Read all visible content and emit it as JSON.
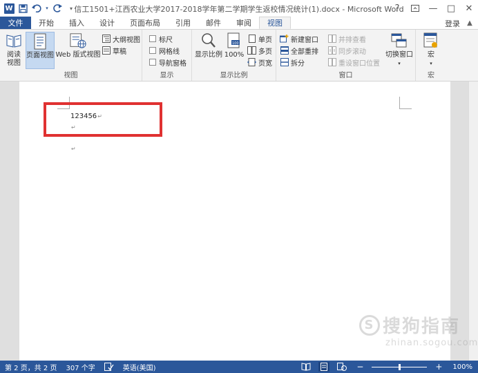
{
  "window": {
    "title": "信工1501+江西农业大学2017-2018学年第二学期学生返校情况统计(1).docx - Microsoft Word",
    "help": "?",
    "minimize": "—",
    "restore": "□",
    "close": "✕"
  },
  "quick_access": {
    "app_icon": "word-icon",
    "save_icon": "save-icon",
    "undo_icon": "undo-icon",
    "redo_icon": "redo-icon",
    "customize_icon": "customize-icon"
  },
  "tabs": [
    {
      "label": "文件"
    },
    {
      "label": "开始"
    },
    {
      "label": "插入"
    },
    {
      "label": "设计"
    },
    {
      "label": "页面布局"
    },
    {
      "label": "引用"
    },
    {
      "label": "邮件"
    },
    {
      "label": "审阅"
    },
    {
      "label": "视图"
    }
  ],
  "active_tab": "视图",
  "login": "登录",
  "ribbon": {
    "views": {
      "label": "视图",
      "read_mode": "阅读\n视图",
      "read_mode_1": "阅读",
      "read_mode_2": "视图",
      "print_layout": "页面视图",
      "web_layout": "Web 版式视图",
      "outline": "大纲视图",
      "draft": "草稿"
    },
    "show": {
      "label": "显示",
      "ruler": "标尺",
      "gridlines": "网格线",
      "nav_pane": "导航窗格"
    },
    "zoom": {
      "label": "显示比例",
      "zoom": "显示比例",
      "hundred": "100%",
      "one_page": "单页",
      "multi_page": "多页",
      "page_width": "页宽"
    },
    "window": {
      "label": "窗口",
      "new_window": "新建窗口",
      "arrange_all": "全部重排",
      "split": "拆分",
      "side_by_side": "并排查看",
      "sync_scroll": "同步滚动",
      "reset_position": "重设窗口位置",
      "switch_windows": "切换窗口"
    },
    "macros": {
      "label": "宏",
      "macros": "宏"
    }
  },
  "document": {
    "lines": [
      "123456",
      "",
      ""
    ],
    "paragraph_mark": "↵"
  },
  "watermark": {
    "main": "搜狗指南",
    "sub": "zhinan.sogou.com",
    "circle": "S"
  },
  "status": {
    "page": "第 2 页，共 2 页",
    "words": "307 个字",
    "language": "英语(美国)",
    "zoom": "100%",
    "zoom_level": 0.5
  },
  "colors": {
    "accent": "#2b579a",
    "highlight": "#e03131"
  }
}
